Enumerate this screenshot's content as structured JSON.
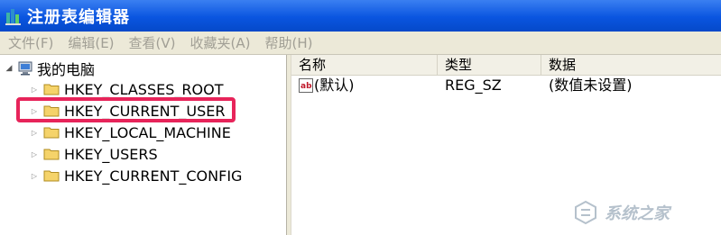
{
  "window": {
    "title": "注册表编辑器"
  },
  "menu": [
    {
      "label": "文件(F)"
    },
    {
      "label": "编辑(E)"
    },
    {
      "label": "查看(V)"
    },
    {
      "label": "收藏夹(A)"
    },
    {
      "label": "帮助(H)"
    }
  ],
  "tree": {
    "root": {
      "label": "我的电脑",
      "expander": "◢"
    },
    "items": [
      {
        "label": "HKEY_CLASSES_ROOT"
      },
      {
        "label": "HKEY_CURRENT_USER",
        "highlighted": true
      },
      {
        "label": "HKEY_LOCAL_MACHINE"
      },
      {
        "label": "HKEY_USERS"
      },
      {
        "label": "HKEY_CURRENT_CONFIG"
      }
    ]
  },
  "list": {
    "columns": [
      "名称",
      "类型",
      "数据"
    ],
    "rows": [
      {
        "name": "(默认)",
        "type": "REG_SZ",
        "data": "(数值未设置)"
      }
    ]
  },
  "watermark": {
    "text": "系统之家"
  },
  "colors": {
    "titlebar": "#0a55e0",
    "menubar": "#ece9d8",
    "highlight_border": "#e7245a",
    "folder": "#f5d36a"
  }
}
